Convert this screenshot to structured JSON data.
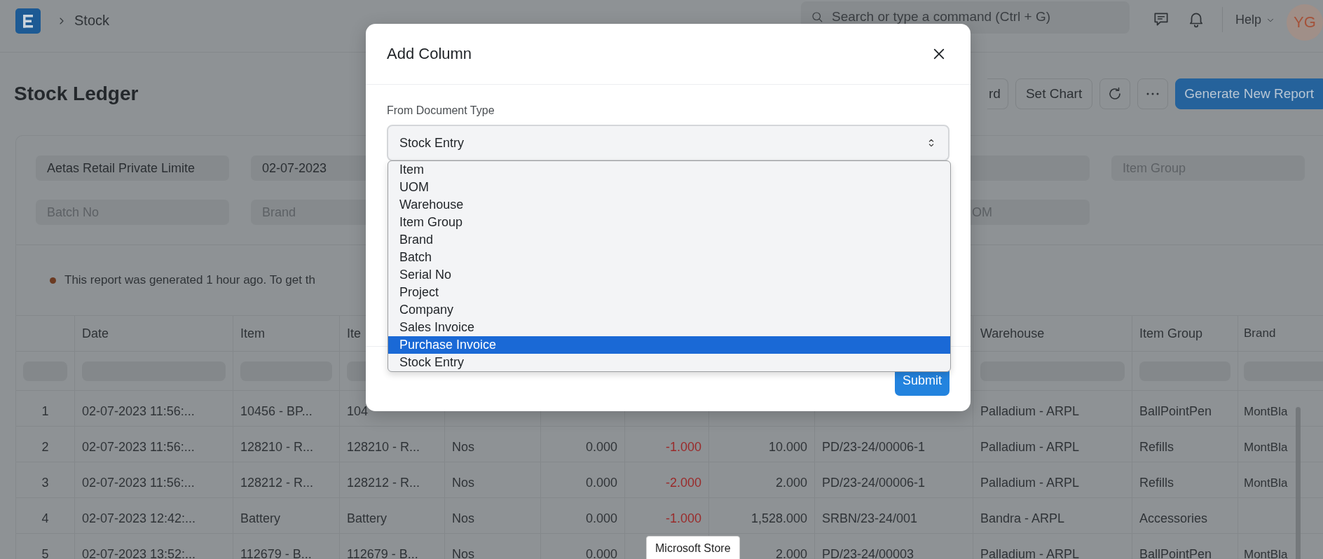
{
  "topbar": {
    "breadcrumb": "Stock",
    "search": {
      "placeholder": "Search or type a command (Ctrl + G)"
    },
    "help": "Help",
    "avatar": "YG"
  },
  "page": {
    "title": "Stock Ledger",
    "actions": [
      {
        "kind": "partial",
        "label": "rd"
      },
      {
        "kind": "text",
        "label": "Set Chart"
      },
      {
        "kind": "refresh"
      },
      {
        "kind": "more"
      },
      {
        "kind": "primary",
        "label": "Generate New Report"
      }
    ]
  },
  "filters": [
    {
      "kind": "value",
      "text": "Aetas Retail Private Limite"
    },
    {
      "kind": "value",
      "text": "02-07-2023"
    },
    {
      "kind": "hidden"
    },
    {
      "kind": "hidden"
    },
    {
      "kind": "covered"
    },
    {
      "kind": "placeholder",
      "placeholder": "Item Group"
    },
    {
      "kind": "placeholder",
      "placeholder": "Batch No"
    },
    {
      "kind": "placeholder",
      "placeholder": "Brand"
    },
    {
      "kind": "hidden"
    },
    {
      "kind": "hidden"
    },
    {
      "kind": "partial",
      "placeholder": "OM"
    }
  ],
  "notice": "This report was generated 1 hour ago. To get th",
  "table": {
    "columns": [
      {
        "kind": "label",
        "label": "Date"
      },
      {
        "kind": "label",
        "label": "Item"
      },
      {
        "kind": "label",
        "label": "Ite"
      },
      {
        "kind": "covered"
      },
      {
        "kind": "covered"
      },
      {
        "kind": "covered"
      },
      {
        "kind": "covered"
      },
      {
        "kind": "covered"
      },
      {
        "kind": "label",
        "label": "Warehouse"
      },
      {
        "kind": "label",
        "label": "Item Group"
      },
      {
        "kind": "label",
        "label": "Brand"
      }
    ],
    "rows": [
      {
        "index": "1",
        "cells": [
          {
            "kind": "text",
            "text": "02-07-2023 11:56:..."
          },
          {
            "kind": "text",
            "text": "10456 - BP..."
          },
          {
            "kind": "text",
            "text": "104"
          },
          {
            "kind": "covered"
          },
          {
            "kind": "covered"
          },
          {
            "kind": "covered"
          },
          {
            "kind": "covered"
          },
          {
            "kind": "covered"
          },
          {
            "kind": "text",
            "text": "Palladium - ARPL"
          },
          {
            "kind": "text",
            "text": "BallPointPen"
          },
          {
            "kind": "text",
            "text": "MontBla"
          }
        ]
      },
      {
        "index": "2",
        "cells": [
          {
            "kind": "text",
            "text": "02-07-2023 11:56:..."
          },
          {
            "kind": "text",
            "text": "128210 - R..."
          },
          {
            "kind": "text",
            "text": "128210 - R..."
          },
          {
            "kind": "text",
            "text": "Nos"
          },
          {
            "kind": "number",
            "text": "0.000"
          },
          {
            "kind": "negative",
            "text": "-1.000"
          },
          {
            "kind": "number",
            "text": "10.000"
          },
          {
            "kind": "text",
            "text": "PD/23-24/00006-1"
          },
          {
            "kind": "text",
            "text": "Palladium - ARPL"
          },
          {
            "kind": "text",
            "text": "Refills"
          },
          {
            "kind": "text",
            "text": "MontBla"
          }
        ]
      },
      {
        "index": "3",
        "cells": [
          {
            "kind": "text",
            "text": "02-07-2023 11:56:..."
          },
          {
            "kind": "text",
            "text": "128212 - R..."
          },
          {
            "kind": "text",
            "text": "128212 - R..."
          },
          {
            "kind": "text",
            "text": "Nos"
          },
          {
            "kind": "number",
            "text": "0.000"
          },
          {
            "kind": "negative",
            "text": "-2.000"
          },
          {
            "kind": "number",
            "text": "2.000"
          },
          {
            "kind": "text",
            "text": "PD/23-24/00006-1"
          },
          {
            "kind": "text",
            "text": "Palladium - ARPL"
          },
          {
            "kind": "text",
            "text": "Refills"
          },
          {
            "kind": "text",
            "text": "MontBla"
          }
        ]
      },
      {
        "index": "4",
        "cells": [
          {
            "kind": "text",
            "text": "02-07-2023 12:42:..."
          },
          {
            "kind": "text",
            "text": "Battery"
          },
          {
            "kind": "text",
            "text": "Battery"
          },
          {
            "kind": "text",
            "text": "Nos"
          },
          {
            "kind": "number",
            "text": "0.000"
          },
          {
            "kind": "negative",
            "text": "-1.000"
          },
          {
            "kind": "number",
            "text": "1,528.000"
          },
          {
            "kind": "text",
            "text": "SRBN/23-24/001"
          },
          {
            "kind": "text",
            "text": "Bandra - ARPL"
          },
          {
            "kind": "text",
            "text": "Accessories"
          },
          {
            "kind": "covered"
          }
        ]
      },
      {
        "index": "5",
        "cells": [
          {
            "kind": "text",
            "text": "02-07-2023 13:52:..."
          },
          {
            "kind": "text",
            "text": "112679 - B..."
          },
          {
            "kind": "text",
            "text": "112679 - B..."
          },
          {
            "kind": "text",
            "text": "Nos"
          },
          {
            "kind": "number",
            "text": "0.000"
          },
          {
            "kind": "covered"
          },
          {
            "kind": "number",
            "text": "2.000"
          },
          {
            "kind": "text",
            "text": "PD/23-24/00003"
          },
          {
            "kind": "text",
            "text": "Palladium - ARPL"
          },
          {
            "kind": "text",
            "text": "BallPointPen"
          },
          {
            "kind": "text",
            "text": "MontBla"
          }
        ]
      }
    ]
  },
  "modal": {
    "title": "Add Column",
    "field_label": "From Document Type",
    "select": {
      "value": "Stock Entry"
    },
    "options": [
      {
        "label": "Item",
        "selected": false
      },
      {
        "label": "UOM",
        "selected": false
      },
      {
        "label": "Warehouse",
        "selected": false
      },
      {
        "label": "Item Group",
        "selected": false
      },
      {
        "label": "Brand",
        "selected": false
      },
      {
        "label": "Batch",
        "selected": false
      },
      {
        "label": "Serial No",
        "selected": false
      },
      {
        "label": "Project",
        "selected": false
      },
      {
        "label": "Company",
        "selected": false
      },
      {
        "label": "Sales Invoice",
        "selected": false
      },
      {
        "label": "Purchase Invoice",
        "selected": true
      },
      {
        "label": "Stock Entry",
        "selected": false
      }
    ],
    "submit": "Submit"
  },
  "tooltip": {
    "text": "Microsoft Store"
  }
}
